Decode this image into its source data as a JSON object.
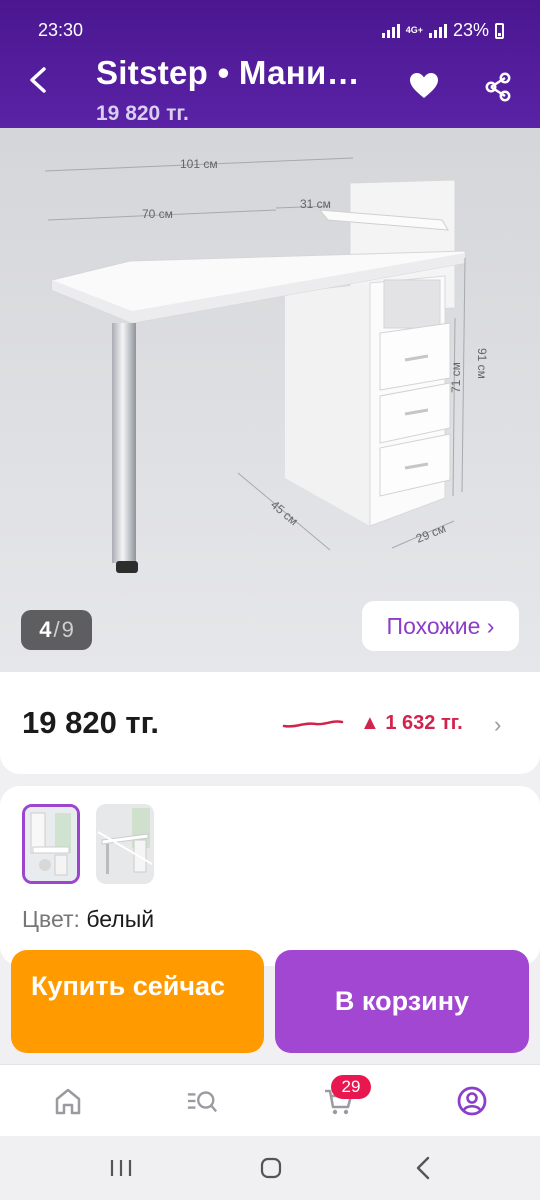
{
  "status_bar": {
    "time": "23:30",
    "network": "4G+",
    "battery": "23%"
  },
  "header": {
    "title": "Sitstep • Мани…",
    "price": "19 820 тг."
  },
  "gallery": {
    "counter_current": "4",
    "counter_total": "9",
    "similar_label": "Похожие ›",
    "dimensions": [
      "101 см",
      "70 см",
      "31 см",
      "91 см",
      "71 см",
      "45 см",
      "29 см"
    ]
  },
  "price_card": {
    "price": "19 820 тг.",
    "delta": "▲ 1 632 тг.",
    "chevron": "›"
  },
  "variant": {
    "color_label": "Цвет:",
    "color_value": "белый"
  },
  "buttons": {
    "buy_now": "Купить сейчас",
    "add_to_cart": "В корзину"
  },
  "bottom_nav": {
    "cart_badge": "29",
    "items": [
      "home-icon",
      "catalog-search-icon",
      "cart-icon",
      "profile-icon"
    ]
  },
  "colors": {
    "header": "#5a22a6",
    "accent_purple": "#a247d2",
    "buy_orange": "#ff9a00",
    "price_up_red": "#d2234d"
  }
}
